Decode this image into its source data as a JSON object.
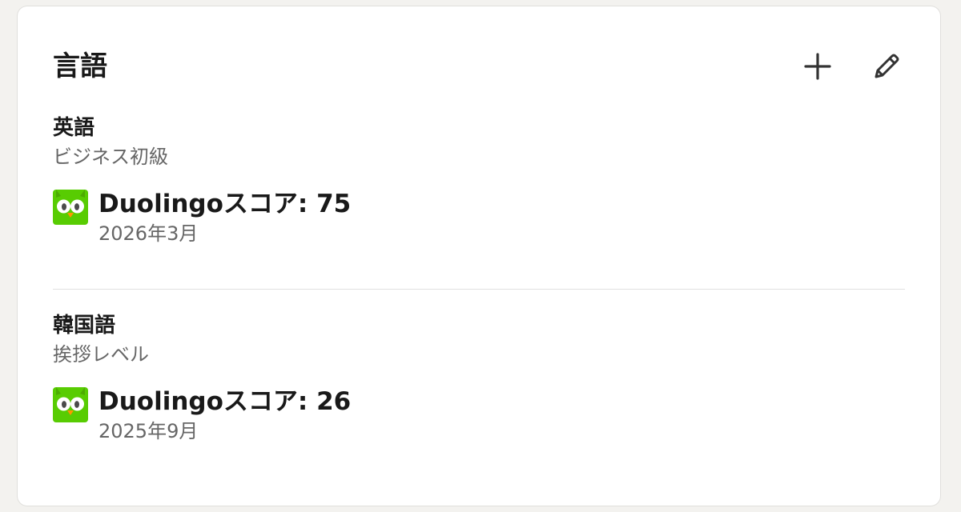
{
  "section": {
    "title": "言語",
    "add_icon": "plus-icon",
    "edit_icon": "pencil-icon"
  },
  "languages": [
    {
      "name": "英語",
      "level": "ビジネス初級",
      "certification": {
        "logo_icon": "duolingo-owl-icon",
        "title": "Duolingoスコア: 75",
        "date": "2026年3月"
      }
    },
    {
      "name": "韓国語",
      "level": "挨拶レベル",
      "certification": {
        "logo_icon": "duolingo-owl-icon",
        "title": "Duolingoスコア: 26",
        "date": "2025年9月"
      }
    }
  ],
  "colors": {
    "background": "#f3f2ef",
    "card": "#ffffff",
    "text_primary": "#191919",
    "text_secondary": "#666666",
    "duolingo_green": "#58cc02"
  }
}
